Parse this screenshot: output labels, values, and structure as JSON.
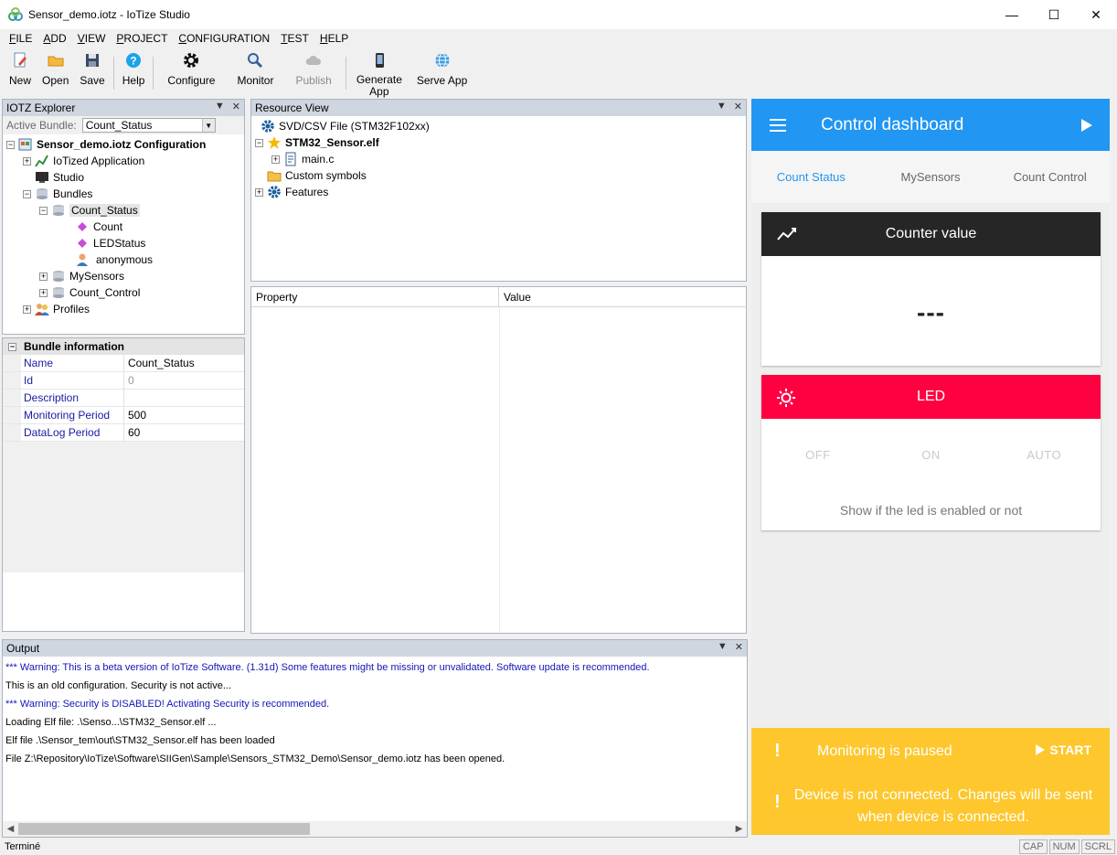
{
  "window": {
    "title": "Sensor_demo.iotz - IoTize Studio"
  },
  "menu": [
    {
      "label": "FILE",
      "ul": "F",
      "rest": "ILE"
    },
    {
      "label": "ADD",
      "ul": "A",
      "rest": "DD"
    },
    {
      "label": "VIEW",
      "ul": "V",
      "rest": "IEW"
    },
    {
      "label": "PROJECT",
      "ul": "P",
      "rest": "ROJECT"
    },
    {
      "label": "CONFIGURATION",
      "ul": "C",
      "rest": "ONFIGURATION"
    },
    {
      "label": "TEST",
      "ul": "T",
      "rest": "EST"
    },
    {
      "label": "HELP",
      "ul": "H",
      "rest": "ELP"
    }
  ],
  "toolbar": {
    "new": "New",
    "open": "Open",
    "save": "Save",
    "help": "Help",
    "configure": "Configure",
    "monitor": "Monitor",
    "publish": "Publish",
    "generate1": "Generate",
    "generate2": "App",
    "serve": "Serve App"
  },
  "explorer": {
    "title": "IOTZ Explorer",
    "active_bundle_label": "Active Bundle:",
    "active_bundle_value": "Count_Status",
    "tree": {
      "root": "Sensor_demo.iotz Configuration",
      "iotized": "IoTized Application",
      "studio": "Studio",
      "bundles": "Bundles",
      "count_status": "Count_Status",
      "count": "Count",
      "ledstatus": "LEDStatus",
      "anonymous": "anonymous",
      "mysensors": "MySensors",
      "count_control": "Count_Control",
      "profiles": "Profiles"
    }
  },
  "bundle_info": {
    "title": "Bundle information",
    "rows": [
      {
        "key": "Name",
        "value": "Count_Status"
      },
      {
        "key": "Id",
        "value": "0"
      },
      {
        "key": "Description",
        "value": ""
      },
      {
        "key": "Monitoring Period",
        "value": "500"
      },
      {
        "key": "DataLog Period",
        "value": "60"
      }
    ]
  },
  "resource_view": {
    "title": "Resource View",
    "svd": "SVD/CSV File (STM32F102xx)",
    "elf": "STM32_Sensor.elf",
    "mainc": "main.c",
    "custom": "Custom symbols",
    "features": "Features"
  },
  "properties": {
    "col_property": "Property",
    "col_value": "Value"
  },
  "output": {
    "title": "Output",
    "lines": [
      {
        "text": "*** Warning: This is a beta version of IoTize Software. (1.31d) Some features might be missing or unvalidated. Software update is recommended.",
        "warn": true
      },
      {
        "text": "This is an old configuration. Security is not active...",
        "warn": false
      },
      {
        "text": "*** Warning: Security is DISABLED! Activating Security is recommended.",
        "warn": true
      },
      {
        "text": "Loading Elf file: .\\Senso...\\STM32_Sensor.elf ...",
        "warn": false
      },
      {
        "text": "Elf file .\\Sensor_tem\\out\\STM32_Sensor.elf has been loaded",
        "warn": false
      },
      {
        "text": "File Z:\\Repository\\IoTize\\Software\\SIIGen\\Sample\\Sensors_STM32_Demo\\Sensor_demo.iotz has been opened.",
        "warn": false
      }
    ]
  },
  "status": {
    "text": "Terminé",
    "cap": "CAP",
    "num": "NUM",
    "scrl": "SCRL"
  },
  "dashboard": {
    "title": "Control dashboard",
    "tabs": [
      "Count Status",
      "MySensors",
      "Count Control"
    ],
    "counter_title": "Counter value",
    "counter_value": "---",
    "led_title": "LED",
    "led_off": "OFF",
    "led_on": "ON",
    "led_auto": "AUTO",
    "led_desc": "Show if the led is enabled or not",
    "monitoring": "Monitoring is paused",
    "start": "START",
    "exclaim": "!",
    "not_connected": "Device is not connected. Changes will be sent when device is connected.",
    "colors": {
      "bar": "#2196f3",
      "counter": "#262626",
      "led": "#ff0041",
      "warning": "#fdc72d"
    }
  }
}
